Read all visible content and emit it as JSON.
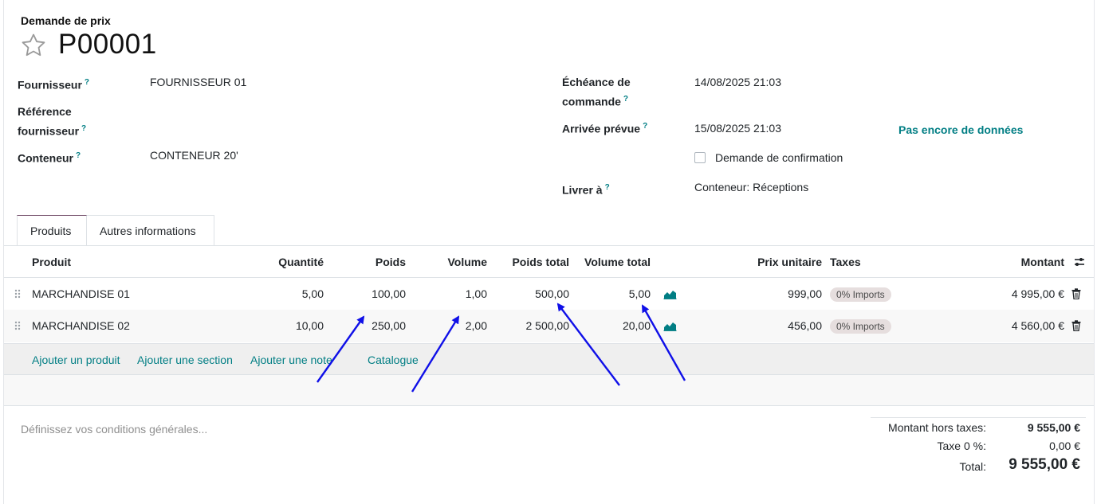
{
  "header": {
    "doc_type": "Demande de prix",
    "name": "P00001"
  },
  "form": {
    "supplier_label": "Fournisseur",
    "supplier_value": "FOURNISSEUR 01",
    "supplier_ref_label_1": "Référence",
    "supplier_ref_label_2": "fournisseur",
    "container_label": "Conteneur",
    "container_value": "CONTENEUR 20'",
    "deadline_label_1": "Échéance de",
    "deadline_label_2": "commande",
    "deadline_value": "14/08/2025 21:03",
    "arrival_label": "Arrivée prévue",
    "arrival_value": "15/08/2025 21:03",
    "no_data": "Pas encore de données",
    "confirm_label": "Demande de confirmation",
    "deliver_label": "Livrer à",
    "deliver_value": "Conteneur: Réceptions",
    "help_mark": "?"
  },
  "tabs": [
    {
      "label": "Produits"
    },
    {
      "label": "Autres informations"
    }
  ],
  "table": {
    "headers": {
      "product": "Produit",
      "qty": "Quantité",
      "weight": "Poids",
      "volume": "Volume",
      "total_weight": "Poids total",
      "total_volume": "Volume total",
      "unit_price": "Prix unitaire",
      "taxes": "Taxes",
      "amount": "Montant"
    },
    "rows": [
      {
        "product": "MARCHANDISE 01",
        "qty": "5,00",
        "weight": "100,00",
        "volume": "1,00",
        "total_weight": "500,00",
        "total_volume": "5,00",
        "unit_price": "999,00",
        "tax": "0% Imports",
        "amount": "4 995,00 €"
      },
      {
        "product": "MARCHANDISE 02",
        "qty": "10,00",
        "weight": "250,00",
        "volume": "2,00",
        "total_weight": "2 500,00",
        "total_volume": "20,00",
        "unit_price": "456,00",
        "tax": "0% Imports",
        "amount": "4 560,00 €"
      }
    ],
    "add_links": {
      "product": "Ajouter un produit",
      "section": "Ajouter une section",
      "note": "Ajouter une note",
      "catalog": "Catalogue"
    }
  },
  "footer": {
    "terms_placeholder": "Définissez vos conditions générales...",
    "untaxed_label": "Montant hors taxes:",
    "untaxed_value": "9 555,00 €",
    "tax_label": "Taxe 0 %:",
    "tax_value": "0,00 €",
    "total_label": "Total:",
    "total_value": "9 555,00 €"
  },
  "colors": {
    "accent": "#017e84",
    "arrow": "#1010e8",
    "tab_active": "#714b67"
  },
  "icons": [
    "star-icon",
    "help-icon",
    "drag-handle-icon",
    "forecast-chart-icon",
    "trash-icon",
    "optional-columns-icon"
  ]
}
